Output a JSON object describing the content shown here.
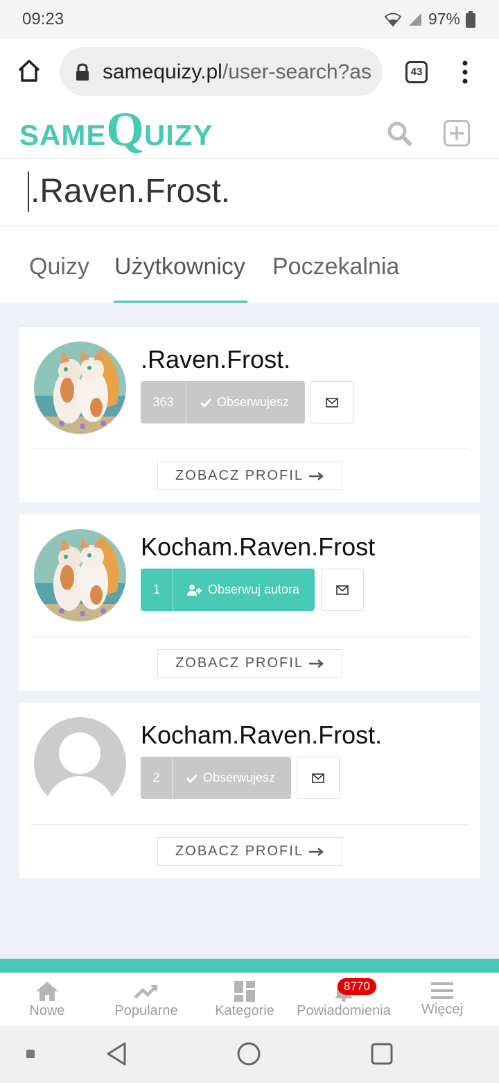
{
  "status_bar": {
    "time": "09:23",
    "battery": "97%"
  },
  "browser": {
    "url_domain": "samequizy.pl",
    "url_path": "/user-search?as",
    "tab_count": "43"
  },
  "site": {
    "logo_same": "SAME",
    "logo_q": "Q",
    "logo_rest": "UIZY",
    "brand_color": "#47c9b3"
  },
  "search": {
    "query": ".Raven.Frost."
  },
  "tabs": [
    {
      "label": "Quizy"
    },
    {
      "label": "Użytkownicy"
    },
    {
      "label": "Poczekalnia"
    }
  ],
  "users": [
    {
      "name": ".Raven.Frost.",
      "followers": "363",
      "follow_label": "Obserwujesz",
      "following": true,
      "avatar": "cats-illustration",
      "profile_label": "ZOBACZ PROFIL"
    },
    {
      "name": "Kocham.Raven.Frost",
      "followers": "1",
      "follow_label": "Obserwuj autora",
      "following": false,
      "avatar": "cats-illustration",
      "profile_label": "ZOBACZ PROFIL"
    },
    {
      "name": "Kocham.Raven.Frost.",
      "followers": "2",
      "follow_label": "Obserwujesz",
      "following": true,
      "avatar": "default-avatar",
      "profile_label": "ZOBACZ PROFIL"
    }
  ],
  "bottom_nav": {
    "items": [
      {
        "label": "Nowe",
        "icon": "home-icon"
      },
      {
        "label": "Popularne",
        "icon": "trending-icon"
      },
      {
        "label": "Kategorie",
        "icon": "grid-icon"
      },
      {
        "label": "Powiadomienia",
        "icon": "bell-icon"
      },
      {
        "label": "Więcej",
        "icon": "menu-icon"
      }
    ],
    "notification_count": "8770"
  }
}
